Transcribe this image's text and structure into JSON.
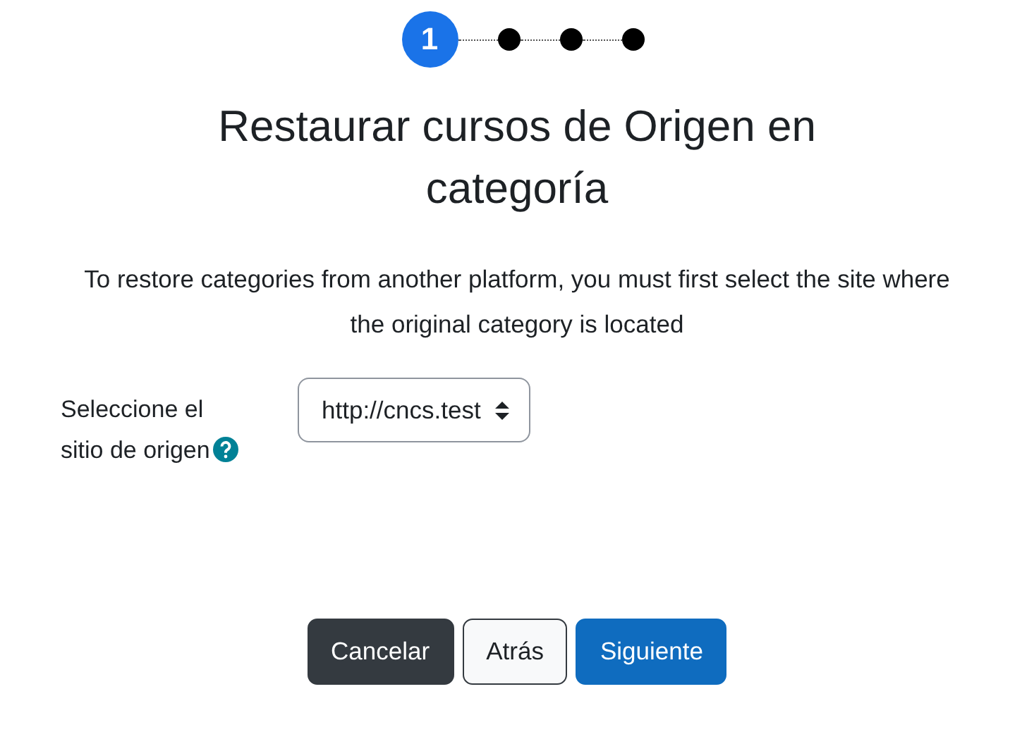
{
  "steps": [
    {
      "label": "1",
      "selected": true
    },
    {
      "selected": false
    },
    {
      "selected": false
    },
    {
      "selected": false
    }
  ],
  "title": "Restaurar cursos de Origen en categoría",
  "description": "To restore categories from another platform, you must first select the site where the original category is located",
  "field": {
    "label": "Seleccione el sitio de origen",
    "value": "http://cncs.test"
  },
  "buttons": [
    {
      "label": "Cancelar",
      "kind": "dark"
    },
    {
      "label": "Atrás",
      "kind": "outline"
    },
    {
      "label": "Siguiente",
      "kind": "primary"
    }
  ]
}
